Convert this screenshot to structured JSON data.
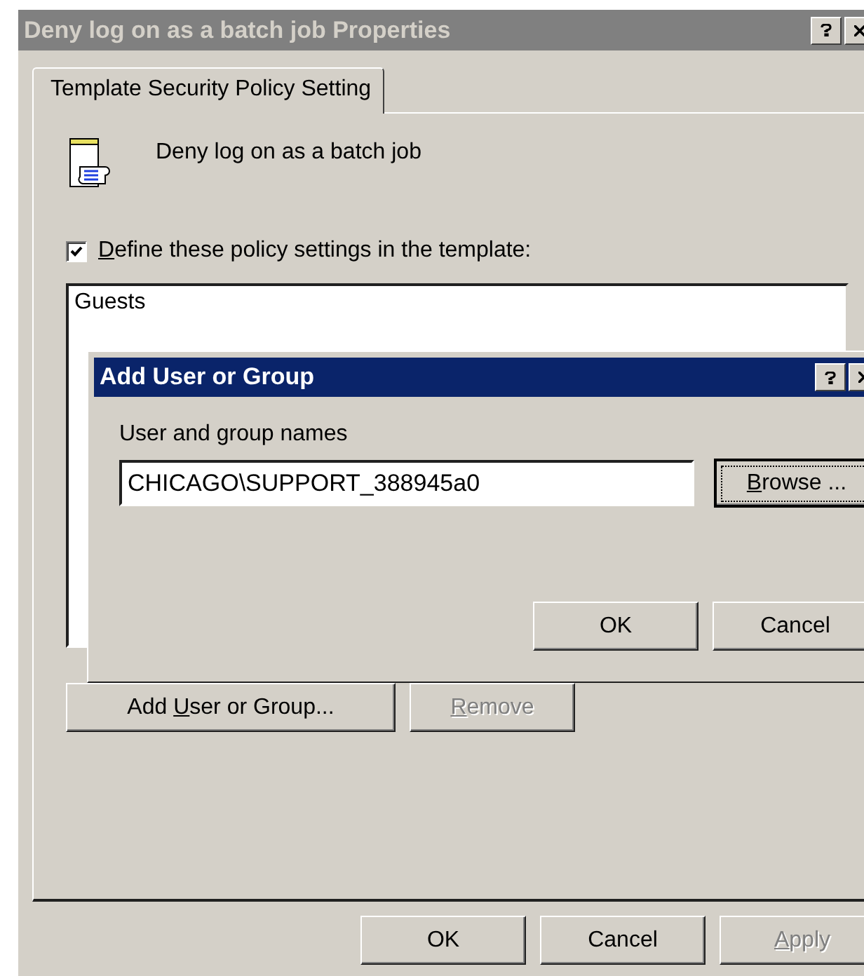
{
  "window": {
    "title": "Deny log on as a batch job Properties",
    "active": false
  },
  "tabs": [
    {
      "label": "Template Security Policy Setting",
      "selected": true
    }
  ],
  "policy": {
    "name": "Deny log on as a batch job"
  },
  "define_checkbox": {
    "label": [
      {
        "text": "D",
        "underline": true
      },
      {
        "text": "efine these policy settings in the template:",
        "underline": false
      }
    ],
    "checked": true
  },
  "members_list": {
    "items": [
      {
        "label": "Guests",
        "selected": false
      }
    ]
  },
  "list_buttons": [
    {
      "label": [
        {
          "text": "Add ",
          "underline": false
        },
        {
          "text": "U",
          "underline": true
        },
        {
          "text": "ser or Group...",
          "underline": false
        }
      ],
      "disabled": false,
      "focused": false
    },
    {
      "label": [
        {
          "text": "R",
          "underline": true
        },
        {
          "text": "emove",
          "underline": false
        }
      ],
      "disabled": true,
      "focused": false
    }
  ],
  "add_dialog": {
    "title": "Add User or Group",
    "active": true,
    "field_label": "User and group names",
    "field_value": "CHICAGO\\SUPPORT_388945a0",
    "browse_button": {
      "label": [
        {
          "text": "B",
          "underline": true
        },
        {
          "text": "rowse ...",
          "underline": false
        }
      ],
      "disabled": false,
      "focused": true
    },
    "buttons": [
      {
        "label": [
          {
            "text": "OK",
            "underline": false
          }
        ],
        "disabled": false,
        "focused": false
      },
      {
        "label": [
          {
            "text": "Cancel",
            "underline": false
          }
        ],
        "disabled": false,
        "focused": false
      }
    ]
  },
  "buttons": [
    {
      "label": [
        {
          "text": "OK",
          "underline": false
        }
      ],
      "disabled": false,
      "focused": false
    },
    {
      "label": [
        {
          "text": "Cancel",
          "underline": false
        }
      ],
      "disabled": false,
      "focused": false
    },
    {
      "label": [
        {
          "text": "A",
          "underline": true
        },
        {
          "text": "pply",
          "underline": false
        }
      ],
      "disabled": true,
      "focused": false
    }
  ]
}
